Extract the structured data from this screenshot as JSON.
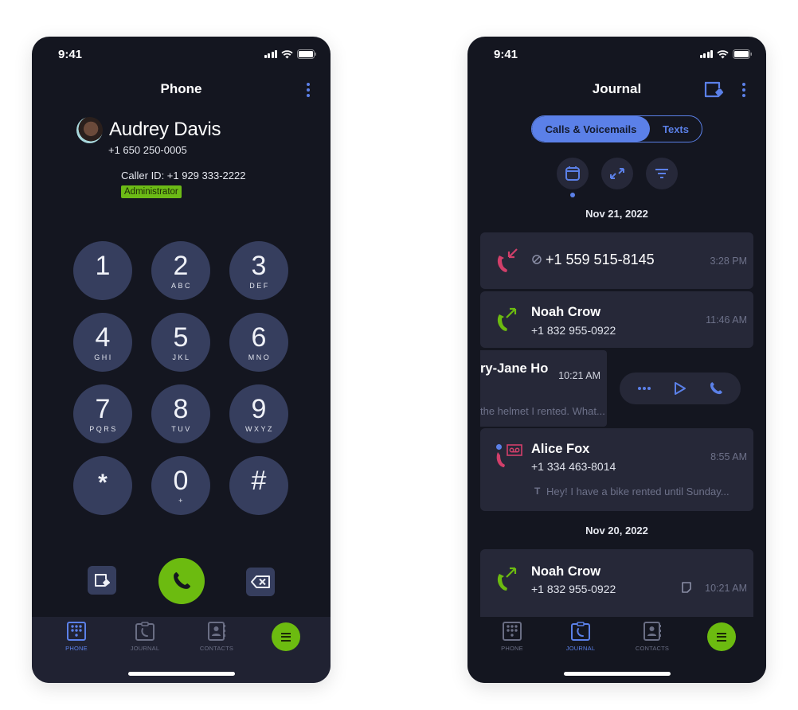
{
  "status_bar": {
    "time": "9:41"
  },
  "colors": {
    "background": "#141620",
    "card": "#262838",
    "key": "#363e5e",
    "accent": "#5b80e8",
    "green": "#6cbb10",
    "missed": "#d23f6a",
    "muted_text": "#6d7189"
  },
  "phone_screen": {
    "title": "Phone",
    "contact": {
      "name": "Audrey Davis",
      "phone": "+1 650 250-0005",
      "caller_id": "Caller ID: +1 929 333-2222",
      "role_badge": "Administrator"
    },
    "keypad": [
      {
        "digit": "1",
        "letters": ""
      },
      {
        "digit": "2",
        "letters": "ABC"
      },
      {
        "digit": "3",
        "letters": "DEF"
      },
      {
        "digit": "4",
        "letters": "GHI"
      },
      {
        "digit": "5",
        "letters": "JKL"
      },
      {
        "digit": "6",
        "letters": "MNO"
      },
      {
        "digit": "7",
        "letters": "PQRS"
      },
      {
        "digit": "8",
        "letters": "TUV"
      },
      {
        "digit": "9",
        "letters": "WXYZ"
      },
      {
        "digit": "*",
        "letters": ""
      },
      {
        "digit": "0",
        "letters": "+"
      },
      {
        "digit": "#",
        "letters": ""
      }
    ],
    "actions": {
      "message_icon": "message-compose-icon",
      "call_icon": "phone-icon",
      "backspace_icon": "backspace-icon"
    }
  },
  "journal_screen": {
    "title": "Journal",
    "tabs": [
      {
        "label": "Calls & Voicemails",
        "active": true
      },
      {
        "label": "Texts",
        "active": false
      }
    ],
    "filters": [
      {
        "icon": "calendar-icon",
        "active": true
      },
      {
        "icon": "call-direction-icon",
        "active": false
      },
      {
        "icon": "filter-icon",
        "active": false
      }
    ],
    "groups": [
      {
        "date": "Nov 21, 2022",
        "entries": [
          {
            "type": "missed",
            "blocked": true,
            "name": "+1 559 515-8145",
            "phone": "",
            "time": "3:28 PM"
          },
          {
            "type": "outgoing",
            "name": "Noah Crow",
            "phone": "+1 832 955-0922",
            "time": "11:46 AM"
          },
          {
            "type": "swiped",
            "name": "ry-Jane Ho",
            "phone": "",
            "time": "10:21 AM",
            "preview": "the helmet I rented. What...",
            "swipe_actions": [
              "more-icon",
              "play-icon",
              "phone-icon"
            ]
          },
          {
            "type": "voicemail",
            "unread": true,
            "name": "Alice Fox",
            "phone": "+1 334 463-8014",
            "time": "8:55 AM",
            "preview": "Hey! I have a bike rented until Sunday..."
          }
        ]
      },
      {
        "date": "Nov 20, 2022",
        "entries": [
          {
            "type": "outgoing",
            "name": "Noah Crow",
            "phone": "+1 832 955-0922",
            "time": "10:21 AM",
            "has_note": true
          }
        ]
      }
    ]
  },
  "nav": {
    "items": [
      {
        "label": "PHONE",
        "icon": "dialpad-icon"
      },
      {
        "label": "JOURNAL",
        "icon": "journal-icon"
      },
      {
        "label": "CONTACTS",
        "icon": "contacts-icon"
      }
    ],
    "menu_icon": "menu-icon",
    "left_active": "PHONE",
    "right_active": "JOURNAL"
  }
}
